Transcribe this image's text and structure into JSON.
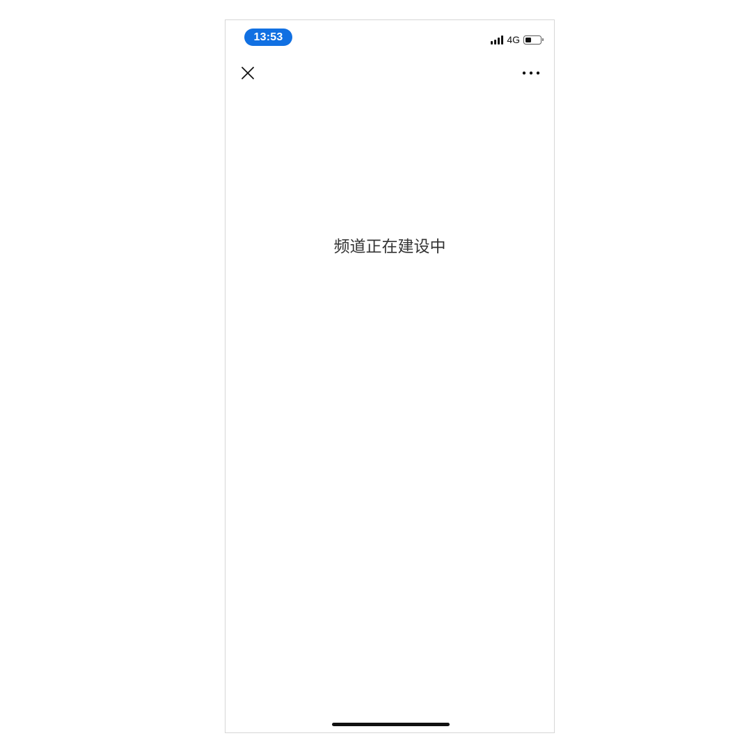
{
  "status_bar": {
    "time": "13:53",
    "network": "4G",
    "battery_level": 0.4,
    "signal_bars": 4,
    "accent_color": "#1170e2"
  },
  "nav": {
    "close_icon": "close-icon",
    "more_icon": "more-icon"
  },
  "content": {
    "message": "频道正在建设中"
  }
}
